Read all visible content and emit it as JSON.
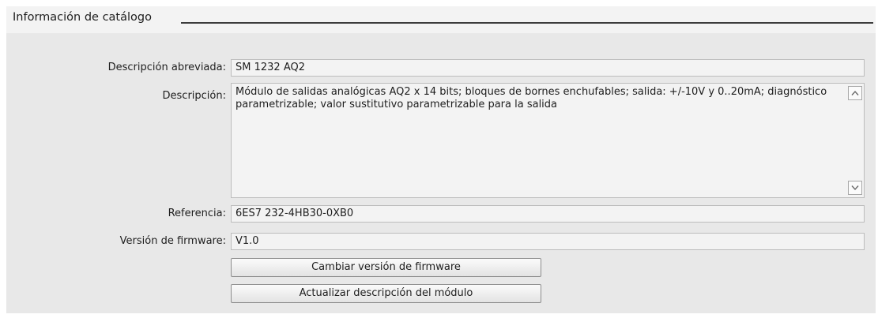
{
  "section": {
    "title": "Información de catálogo"
  },
  "fields": {
    "short_description": {
      "label": "Descripción abreviada:",
      "value": "SM 1232 AQ2"
    },
    "description": {
      "label": "Descripción:",
      "value": "Módulo de salidas analógicas AQ2 x 14 bits; bloques de bornes enchufables; salida: +/-10V y 0..20mA; diagnóstico parametrizable; valor sustitutivo parametrizable para la salida"
    },
    "reference": {
      "label": "Referencia:",
      "value": "6ES7 232-4HB30-0XB0"
    },
    "firmware_version": {
      "label": "Versión de firmware:",
      "value": "V1.0"
    }
  },
  "buttons": {
    "change_firmware": "Cambiar versión de firmware",
    "update_description": "Actualizar descripción del módulo"
  }
}
